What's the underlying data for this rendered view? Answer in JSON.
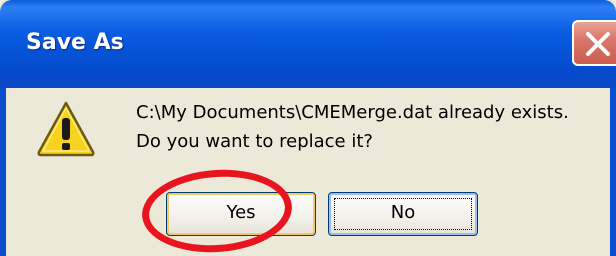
{
  "dialog": {
    "title": "Save As",
    "message_line1": "C:\\My Documents\\CMEMerge.dat already exists.",
    "message_line2": "Do you want to replace it?",
    "icon": "warning-icon"
  },
  "buttons": {
    "yes_label": "Yes",
    "no_label": "No"
  },
  "colors": {
    "titlebar": "#0a5ee2",
    "dialog_background": "#ece9d8",
    "highlight_ring": "#e8151e",
    "warning_yellow": "#f7d21e"
  }
}
